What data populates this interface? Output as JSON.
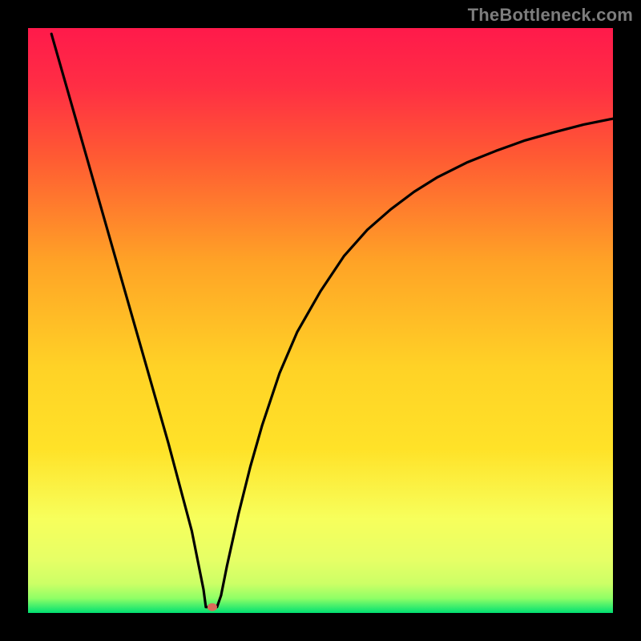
{
  "watermark": "TheBottleneck.com",
  "chart_data": {
    "type": "line",
    "title": "",
    "xlabel": "",
    "ylabel": "",
    "xlim": [
      0,
      100
    ],
    "ylim": [
      0,
      100
    ],
    "grid": false,
    "legend": false,
    "background_gradient": {
      "top_color": "#ff1a4b",
      "mid_colors": [
        "#ff5a33",
        "#ffa326",
        "#ffe228",
        "#f7ff5c",
        "#ccff66"
      ],
      "bottom_color": "#00e072"
    },
    "curve_color": "#000000",
    "marker": {
      "x": 31.5,
      "y": 1.0,
      "color": "#d96b5a"
    },
    "series": [
      {
        "name": "bottleneck-curve",
        "description": "V-shaped curve sampled as (x, y) where y=100 is top and y=0 is bottom (green band). Left branch is nearly straight, right branch rises with decreasing slope.",
        "points": [
          {
            "x": 4.0,
            "y": 99.0
          },
          {
            "x": 6.0,
            "y": 92.0
          },
          {
            "x": 8.0,
            "y": 85.0
          },
          {
            "x": 10.0,
            "y": 78.0
          },
          {
            "x": 12.0,
            "y": 71.0
          },
          {
            "x": 14.0,
            "y": 64.0
          },
          {
            "x": 16.0,
            "y": 57.0
          },
          {
            "x": 18.0,
            "y": 50.0
          },
          {
            "x": 20.0,
            "y": 43.0
          },
          {
            "x": 22.0,
            "y": 36.0
          },
          {
            "x": 24.0,
            "y": 29.0
          },
          {
            "x": 26.0,
            "y": 21.5
          },
          {
            "x": 28.0,
            "y": 14.0
          },
          {
            "x": 29.0,
            "y": 9.0
          },
          {
            "x": 30.0,
            "y": 4.0
          },
          {
            "x": 30.4,
            "y": 1.0
          },
          {
            "x": 32.3,
            "y": 1.0
          },
          {
            "x": 33.0,
            "y": 3.0
          },
          {
            "x": 34.0,
            "y": 8.0
          },
          {
            "x": 36.0,
            "y": 17.0
          },
          {
            "x": 38.0,
            "y": 25.0
          },
          {
            "x": 40.0,
            "y": 32.0
          },
          {
            "x": 43.0,
            "y": 41.0
          },
          {
            "x": 46.0,
            "y": 48.0
          },
          {
            "x": 50.0,
            "y": 55.0
          },
          {
            "x": 54.0,
            "y": 61.0
          },
          {
            "x": 58.0,
            "y": 65.5
          },
          {
            "x": 62.0,
            "y": 69.0
          },
          {
            "x": 66.0,
            "y": 72.0
          },
          {
            "x": 70.0,
            "y": 74.5
          },
          {
            "x": 75.0,
            "y": 77.0
          },
          {
            "x": 80.0,
            "y": 79.0
          },
          {
            "x": 85.0,
            "y": 80.8
          },
          {
            "x": 90.0,
            "y": 82.2
          },
          {
            "x": 95.0,
            "y": 83.5
          },
          {
            "x": 100.0,
            "y": 84.5
          }
        ]
      }
    ]
  }
}
